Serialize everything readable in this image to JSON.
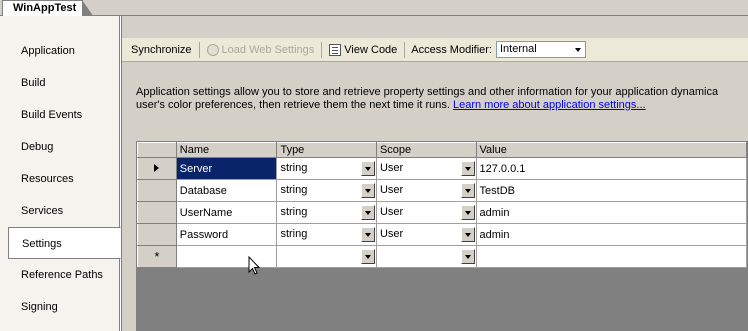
{
  "document_tab": {
    "title": "WinAppTest"
  },
  "sidebar": {
    "items": [
      {
        "label": "Application",
        "active": false
      },
      {
        "label": "Build",
        "active": false
      },
      {
        "label": "Build Events",
        "active": false
      },
      {
        "label": "Debug",
        "active": false
      },
      {
        "label": "Resources",
        "active": false
      },
      {
        "label": "Services",
        "active": false
      },
      {
        "label": "Settings",
        "active": true
      },
      {
        "label": "Reference Paths",
        "active": false
      },
      {
        "label": "Signing",
        "active": false
      }
    ]
  },
  "toolbar": {
    "synchronize_label": "Synchronize",
    "load_web_settings_label": "Load Web Settings",
    "load_web_settings_icon": "globe-icon",
    "view_code_label": "View Code",
    "view_code_icon": "code-file-icon",
    "access_modifier_label": "Access Modifier:",
    "access_modifier_value": "Internal"
  },
  "description": {
    "line1": "Application settings allow you to store and retrieve property settings and other information for your application dynamica",
    "line2": "user's color preferences, then retrieve them the next time it runs. ",
    "link": "Learn more about application settings..."
  },
  "grid": {
    "columns": [
      "Name",
      "Type",
      "Scope",
      "Value"
    ],
    "rows": [
      {
        "name": "Server",
        "type": "string",
        "scope": "User",
        "value": "127.0.0.1",
        "current": true
      },
      {
        "name": "Database",
        "type": "string",
        "scope": "User",
        "value": "TestDB",
        "current": false
      },
      {
        "name": "UserName",
        "type": "string",
        "scope": "User",
        "value": "admin",
        "current": false
      },
      {
        "name": "Password",
        "type": "string",
        "scope": "User",
        "value": "admin",
        "current": false
      }
    ],
    "new_row_marker": "*"
  },
  "colors": {
    "selection": "#0a246a",
    "link": "#0000ee",
    "chrome": "#d4d0c8"
  }
}
